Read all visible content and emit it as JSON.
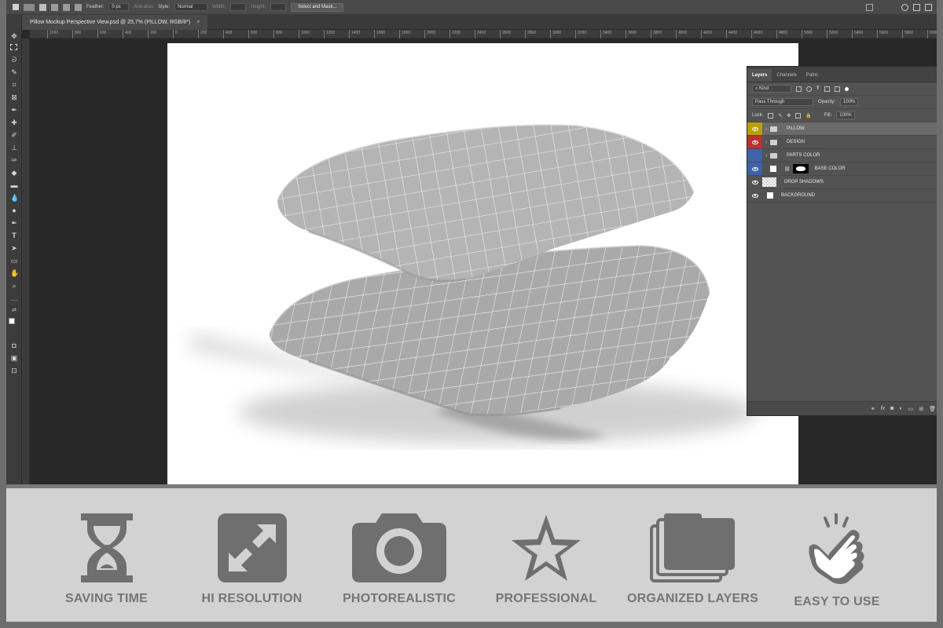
{
  "options_bar": {
    "feather_label": "Feather:",
    "feather_value": "0 px",
    "anti_alias": "Anti-alias",
    "style_label": "Style:",
    "style_value": "Normal",
    "width_label": "Width:",
    "height_label": "Height:",
    "select_mask_button": "Select and Mask..."
  },
  "document_tab": {
    "title": "Pillow Mockup Perspective View.psd @ 25,7% (PILLOW, RGB/8*)",
    "close": "×"
  },
  "ruler_labels": [
    "1000",
    "800",
    "600",
    "400",
    "200",
    "0",
    "200",
    "400",
    "600",
    "800",
    "1000",
    "1200",
    "1400",
    "1600",
    "1800",
    "2000",
    "2200",
    "2400",
    "2600",
    "2800",
    "3000",
    "3200",
    "3400",
    "3600",
    "3800",
    "4000",
    "4200",
    "4400",
    "4600",
    "4800",
    "5000",
    "5200",
    "5400",
    "5600",
    "5800",
    "6000"
  ],
  "layers_panel": {
    "tabs": [
      "Layers",
      "Channels",
      "Paths"
    ],
    "filter_kind": "Kind",
    "blend_mode": "Pass Through",
    "opacity_label": "Opacity:",
    "opacity_value": "100%",
    "lock_label": "Lock:",
    "fill_label": "Fill:",
    "fill_value": "100%",
    "layers": [
      {
        "name": "PILLOW",
        "color": "#b8a000"
      },
      {
        "name": "DESIGN",
        "color": "#b83232"
      },
      {
        "name": "PARTS COLOR",
        "color": "#3f63a8"
      },
      {
        "name": "BASE COLOR",
        "color": "#3f63a8"
      },
      {
        "name": "DROP SHADOWS",
        "color": ""
      },
      {
        "name": "BACKGROUND",
        "color": ""
      }
    ],
    "bottom_icons": [
      "link-icon",
      "fx-icon",
      "mask-icon",
      "adjustment-icon",
      "folder-icon",
      "new-layer-icon",
      "trash-icon"
    ]
  },
  "features": [
    {
      "label": "SAVING TIME",
      "icon": "hourglass-icon"
    },
    {
      "label": "HI RESOLUTION",
      "icon": "expand-arrows-icon"
    },
    {
      "label": "PHOTOREALISTIC",
      "icon": "camera-icon"
    },
    {
      "label": "PROFESSIONAL",
      "icon": "star-icon"
    },
    {
      "label": "ORGANIZED LAYERS",
      "icon": "stacked-layers-icon"
    },
    {
      "label": "EASY TO USE",
      "icon": "hand-tap-icon"
    }
  ],
  "colors": {
    "ps_background": "#282828",
    "panel": "#535353",
    "feature_strip": "#d2d2d2",
    "feature_icon": "#6f6f6f",
    "feature_label": "#757575"
  }
}
